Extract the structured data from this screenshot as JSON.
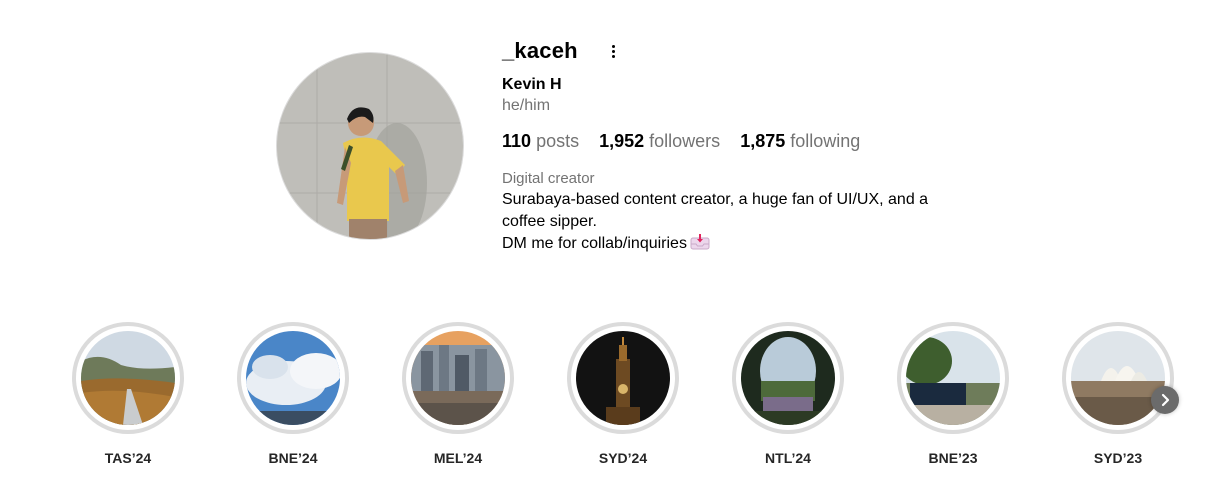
{
  "profile": {
    "username": "_kaceh",
    "full_name": "Kevin H",
    "pronouns": "he/him",
    "category": "Digital creator",
    "bio_lines": [
      "Surabaya-based content creator, a huge fan of UI/UX, and a",
      "coffee sipper.",
      "DM me for collab/inquiries"
    ]
  },
  "stats": {
    "posts_count": "110",
    "posts_label": "posts",
    "followers_count": "1,952",
    "followers_label": "followers",
    "following_count": "1,875",
    "following_label": "following"
  },
  "highlights": [
    {
      "label": "TAS’24"
    },
    {
      "label": "BNE’24"
    },
    {
      "label": "MEL’24"
    },
    {
      "label": "SYD’24"
    },
    {
      "label": "NTL’24"
    },
    {
      "label": "BNE’23"
    },
    {
      "label": "SYD’23"
    }
  ],
  "icons": {
    "more": "more-vertical-icon",
    "inbox": "inbox-tray-icon",
    "next": "chevron-right-icon"
  },
  "colors": {
    "secondary_text": "#737373",
    "ring_border": "#dbdbdb"
  }
}
